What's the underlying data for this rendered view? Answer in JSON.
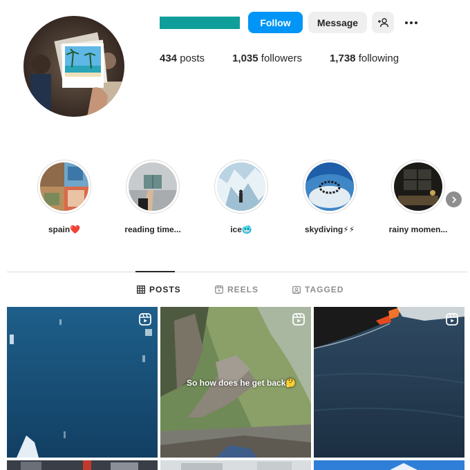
{
  "profile": {
    "avatar_icon": "profile-avatar-photo",
    "username_redacted_color": "#0f9e9a"
  },
  "actions": {
    "follow_label": "Follow",
    "message_label": "Message",
    "add_user_icon": "person-add-icon",
    "more_icon": "more-options-icon"
  },
  "stats": [
    {
      "count": "434",
      "label": "posts"
    },
    {
      "count": "1,035",
      "label": "followers"
    },
    {
      "count": "1,738",
      "label": "following"
    }
  ],
  "highlights": [
    {
      "label": "spain❤️"
    },
    {
      "label": "reading time..."
    },
    {
      "label": "ice🥶"
    },
    {
      "label": "skydiving⚡⚡"
    },
    {
      "label": "rainy momen..."
    }
  ],
  "tabs": [
    {
      "label": "POSTS",
      "icon": "grid-icon",
      "active": true
    },
    {
      "label": "REELS",
      "icon": "reels-icon",
      "active": false
    },
    {
      "label": "TAGGED",
      "icon": "tagged-icon",
      "active": false
    }
  ],
  "posts": [
    {
      "type": "reel",
      "caption": ""
    },
    {
      "type": "reel",
      "caption": "So how does he get back🤔"
    },
    {
      "type": "reel",
      "caption": ""
    }
  ],
  "colors": {
    "accent": "#0095f6",
    "secondary_button": "#efefef",
    "text": "#262626",
    "muted": "#8e8e8e",
    "divider": "#dbdbdb"
  }
}
